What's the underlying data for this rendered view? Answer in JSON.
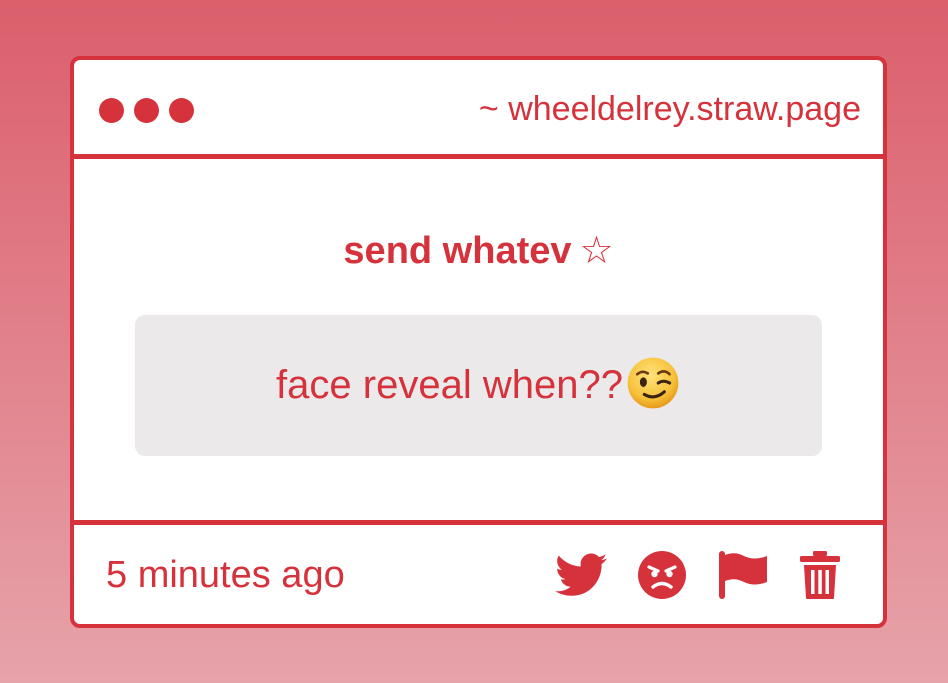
{
  "window": {
    "url": "~ wheeldelrey.straw.page"
  },
  "card": {
    "prompt": "send whatev",
    "star": "☆",
    "message": "face reveal when??"
  },
  "footer": {
    "timestamp": "5 minutes ago",
    "actions": [
      "twitter-icon",
      "angry-face-icon",
      "flag-icon",
      "trash-icon"
    ]
  },
  "colors": {
    "accent": "#d5323b",
    "bubble": "#ebe9ea",
    "background_top": "#db5f6c",
    "background_bottom": "#e7a3aa"
  }
}
